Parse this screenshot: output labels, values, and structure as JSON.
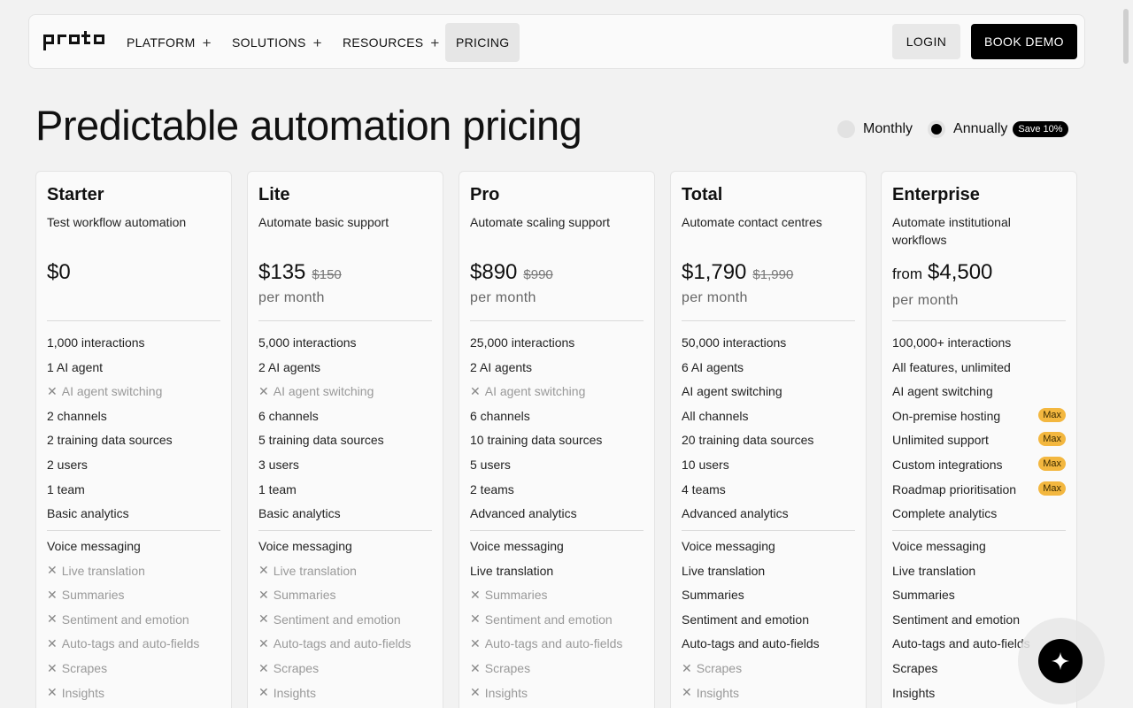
{
  "nav": {
    "logo_text": "proto",
    "items": [
      {
        "label": "PLATFORM",
        "plus": "+"
      },
      {
        "label": "SOLUTIONS",
        "plus": "+"
      },
      {
        "label": "RESOURCES",
        "plus": "+"
      },
      {
        "label": "PRICING",
        "plus": ""
      }
    ],
    "login": "LOGIN",
    "demo": "BOOK DEMO"
  },
  "page": {
    "title": "Predictable automation pricing",
    "billing": {
      "monthly": "Monthly",
      "annually": "Annually",
      "save": "Save 10%",
      "selected": "Annually"
    }
  },
  "plans": [
    {
      "name": "Starter",
      "desc": "Test workflow automation",
      "prefix": "",
      "price": "$0",
      "old_price": "",
      "period": "",
      "limits": [
        {
          "text": "1,000 interactions",
          "off": false
        },
        {
          "text": "1 AI agent",
          "off": false
        },
        {
          "text": "AI agent switching",
          "off": true
        },
        {
          "text": "2 channels",
          "off": false
        },
        {
          "text": "2 training data sources",
          "off": false
        },
        {
          "text": "2 users",
          "off": false
        },
        {
          "text": "1 team",
          "off": false
        },
        {
          "text": "Basic analytics",
          "off": false
        }
      ],
      "features": [
        {
          "text": "Voice messaging",
          "off": false
        },
        {
          "text": "Live translation",
          "off": true
        },
        {
          "text": "Summaries",
          "off": true
        },
        {
          "text": "Sentiment and emotion",
          "off": true
        },
        {
          "text": "Auto-tags and auto-fields",
          "off": true
        },
        {
          "text": "Scrapes",
          "off": true
        },
        {
          "text": "Insights",
          "off": true
        }
      ]
    },
    {
      "name": "Lite",
      "desc": "Automate basic support",
      "prefix": "",
      "price": "$135",
      "old_price": "$150",
      "period": "per month",
      "limits": [
        {
          "text": "5,000 interactions",
          "off": false
        },
        {
          "text": "2 AI agents",
          "off": false
        },
        {
          "text": "AI agent switching",
          "off": true
        },
        {
          "text": "6 channels",
          "off": false
        },
        {
          "text": "5 training data sources",
          "off": false
        },
        {
          "text": "3 users",
          "off": false
        },
        {
          "text": "1 team",
          "off": false
        },
        {
          "text": "Basic analytics",
          "off": false
        }
      ],
      "features": [
        {
          "text": "Voice messaging",
          "off": false
        },
        {
          "text": "Live translation",
          "off": true
        },
        {
          "text": "Summaries",
          "off": true
        },
        {
          "text": "Sentiment and emotion",
          "off": true
        },
        {
          "text": "Auto-tags and auto-fields",
          "off": true
        },
        {
          "text": "Scrapes",
          "off": true
        },
        {
          "text": "Insights",
          "off": true
        }
      ]
    },
    {
      "name": "Pro",
      "desc": "Automate scaling support",
      "prefix": "",
      "price": "$890",
      "old_price": "$990",
      "period": "per month",
      "limits": [
        {
          "text": "25,000 interactions",
          "off": false
        },
        {
          "text": "2 AI agents",
          "off": false
        },
        {
          "text": "AI agent switching",
          "off": true
        },
        {
          "text": "6 channels",
          "off": false
        },
        {
          "text": "10 training data sources",
          "off": false
        },
        {
          "text": "5 users",
          "off": false
        },
        {
          "text": "2 teams",
          "off": false
        },
        {
          "text": "Advanced analytics",
          "off": false
        }
      ],
      "features": [
        {
          "text": "Voice messaging",
          "off": false
        },
        {
          "text": "Live translation",
          "off": false
        },
        {
          "text": "Summaries",
          "off": true
        },
        {
          "text": "Sentiment and emotion",
          "off": true
        },
        {
          "text": "Auto-tags and auto-fields",
          "off": true
        },
        {
          "text": "Scrapes",
          "off": true
        },
        {
          "text": "Insights",
          "off": true
        }
      ]
    },
    {
      "name": "Total",
      "desc": "Automate contact centres",
      "prefix": "",
      "price": "$1,790",
      "old_price": "$1,990",
      "period": "per month",
      "limits": [
        {
          "text": "50,000 interactions",
          "off": false
        },
        {
          "text": "6 AI agents",
          "off": false
        },
        {
          "text": "AI agent switching",
          "off": false
        },
        {
          "text": "All channels",
          "off": false
        },
        {
          "text": "20 training data sources",
          "off": false
        },
        {
          "text": "10 users",
          "off": false
        },
        {
          "text": "4 teams",
          "off": false
        },
        {
          "text": "Advanced analytics",
          "off": false
        }
      ],
      "features": [
        {
          "text": "Voice messaging",
          "off": false
        },
        {
          "text": "Live translation",
          "off": false
        },
        {
          "text": "Summaries",
          "off": false
        },
        {
          "text": "Sentiment and emotion",
          "off": false
        },
        {
          "text": "Auto-tags and auto-fields",
          "off": false
        },
        {
          "text": "Scrapes",
          "off": true
        },
        {
          "text": "Insights",
          "off": true
        }
      ]
    },
    {
      "name": "Enterprise",
      "desc": "Automate institutional workflows",
      "prefix": "from",
      "price": "$4,500",
      "old_price": "",
      "period": "per month",
      "limits": [
        {
          "text": "100,000+ interactions",
          "off": false
        },
        {
          "text": "All features, unlimited",
          "off": false
        },
        {
          "text": "AI agent switching",
          "off": false
        },
        {
          "text": "On-premise hosting",
          "off": false,
          "badge": "Max"
        },
        {
          "text": "Unlimited support",
          "off": false,
          "badge": "Max"
        },
        {
          "text": "Custom integrations",
          "off": false,
          "badge": "Max"
        },
        {
          "text": "Roadmap prioritisation",
          "off": false,
          "badge": "Max"
        },
        {
          "text": "Complete analytics",
          "off": false
        }
      ],
      "features": [
        {
          "text": "Voice messaging",
          "off": false
        },
        {
          "text": "Live translation",
          "off": false
        },
        {
          "text": "Summaries",
          "off": false
        },
        {
          "text": "Sentiment and emotion",
          "off": false
        },
        {
          "text": "Auto-tags and auto-fields",
          "off": false
        },
        {
          "text": "Scrapes",
          "off": false
        },
        {
          "text": "Insights",
          "off": false
        }
      ]
    }
  ],
  "icons": {
    "plus": "plus-icon",
    "cross": "x-icon",
    "assistant": "sparkle-icon"
  },
  "colors": {
    "accent": "#000000",
    "badge": "#f3b73f",
    "background": "#f2f2f2"
  }
}
